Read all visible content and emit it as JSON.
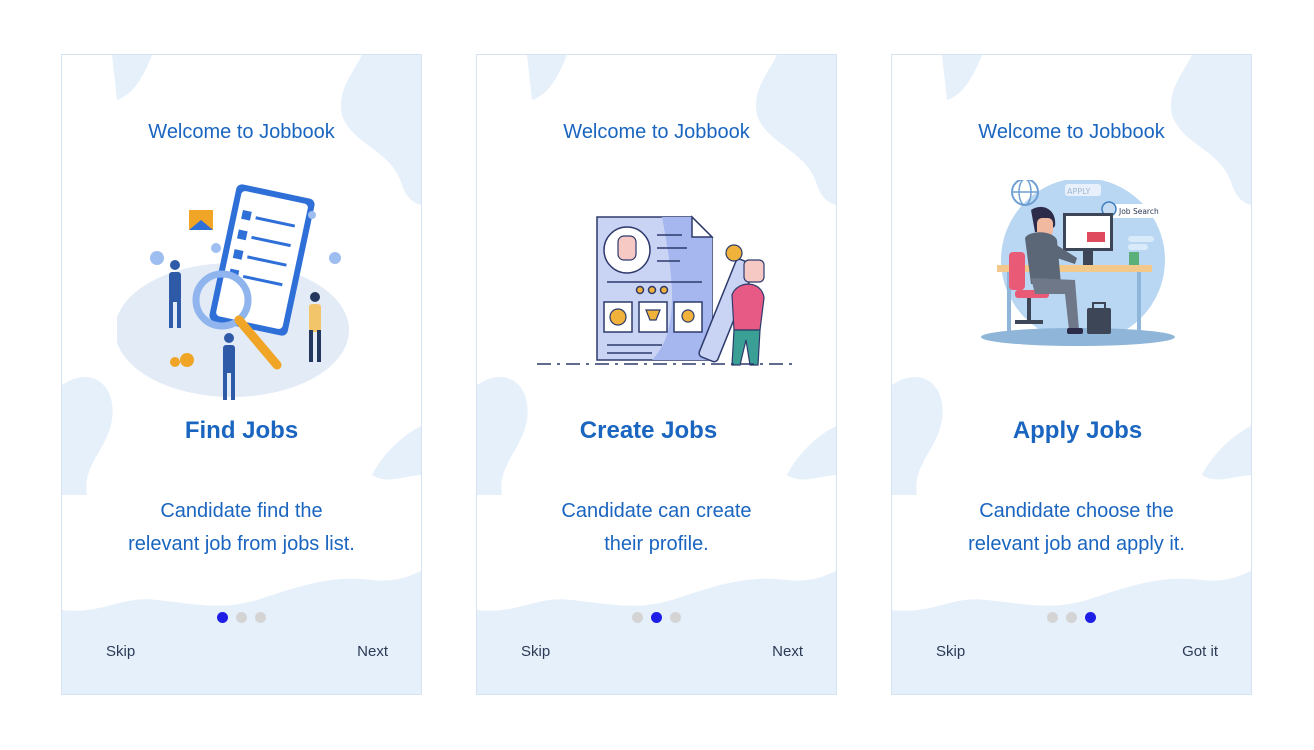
{
  "colors": {
    "primary": "#1a65c0",
    "dot_active": "#1e1ee6",
    "dot_inactive": "#d4d4d4",
    "blob": "#e6f0fa",
    "text_dark": "#2b3a55"
  },
  "screens": [
    {
      "welcome": "Welcome to Jobbook",
      "title": "Find Jobs",
      "description": [
        "Candidate find the",
        "relevant job from jobs list."
      ],
      "illustration": "find-jobs-illustration",
      "active_step": 1,
      "skip_label": "Skip",
      "next_label": "Next"
    },
    {
      "welcome": "Welcome to Jobbook",
      "title": "Create Jobs",
      "description": [
        "Candidate can create",
        "their profile."
      ],
      "illustration": "create-profile-illustration",
      "active_step": 2,
      "skip_label": "Skip",
      "next_label": "Next"
    },
    {
      "welcome": "Welcome to Jobbook",
      "title": "Apply Jobs",
      "description": [
        "Candidate choose the",
        "relevant job and apply it."
      ],
      "illustration": "apply-jobs-illustration",
      "active_step": 3,
      "skip_label": "Skip",
      "next_label": "Got it",
      "illustration_text": {
        "apply": "APPLY",
        "job_search": "Job Search"
      }
    }
  ]
}
